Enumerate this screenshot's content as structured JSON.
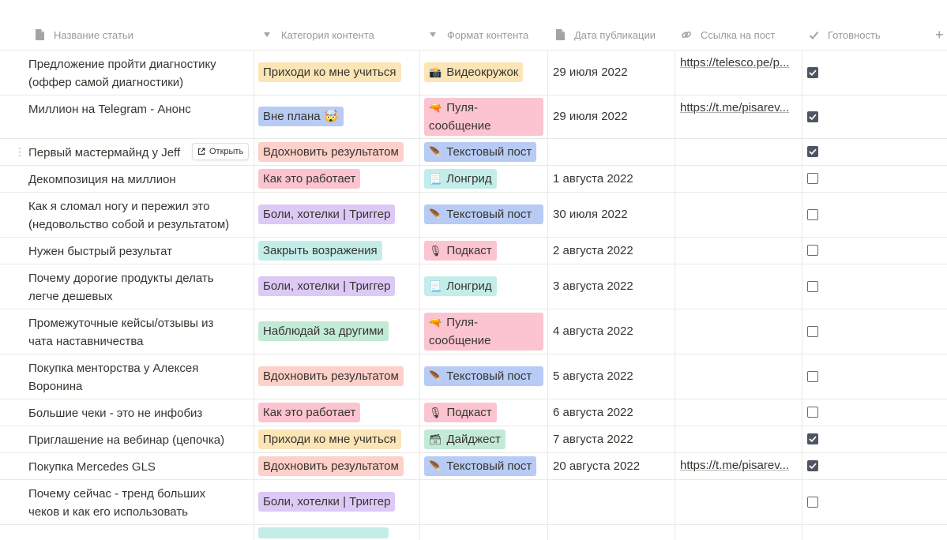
{
  "headers": {
    "title": "Название статьи",
    "category": "Категория контента",
    "format": "Формат контента",
    "date": "Дата публикации",
    "link": "Ссылка на пост",
    "ready": "Готовность",
    "add": "+"
  },
  "open_button": "Открыть",
  "colors": {
    "yellow": "#fbe5b6",
    "purple": "#dcc9f6",
    "red": "#fdd0c9",
    "pink": "#fbc4d0",
    "blue": "#b7cbf4",
    "teal": "#c4ede9",
    "green": "#c3ead7",
    "checkbox": "#4f5563"
  },
  "rows": [
    {
      "title": [
        "Предложение пройти диагностику",
        "(оффер самой диагностики)"
      ],
      "category": "Приходи ко мне учиться",
      "cat_color": "yellow",
      "format_emoji": "📸",
      "format": "Видеокружок",
      "fmt_color": "yellow",
      "date": "29 июля 2022",
      "link": "https://telesco.pe/p...",
      "done": true
    },
    {
      "title": [
        "Миллион на Telegram - Анонс"
      ],
      "category": "Вне плана 🤯",
      "cat_color": "blue",
      "format_emoji": "🔫",
      "format": "Пуля-сообщение",
      "fmt_color": "pink",
      "date": "29 июля 2022",
      "link": "https://t.me/pisarev...",
      "done": true
    },
    {
      "title": [
        "Первый мастермайнд у Jeff"
      ],
      "category": "Вдохновить результатом",
      "cat_color": "red",
      "format_emoji": "🪶",
      "format": "Текстовый пост",
      "fmt_color": "blue",
      "date": "",
      "link": "",
      "done": true
    },
    {
      "title": [
        "Декомпозиция на миллион"
      ],
      "category": "Как это работает",
      "cat_color": "pink",
      "format_emoji": "📃",
      "format": "Лонгрид",
      "fmt_color": "teal",
      "date": "1 августа 2022",
      "link": "",
      "done": false
    },
    {
      "title": [
        "Как я сломал ногу и пережил это",
        "(недовольство собой и результатом)"
      ],
      "category": "Боли, хотелки | Триггер",
      "cat_color": "purple",
      "format_emoji": "🪶",
      "format": "Текстовый пост",
      "fmt_color": "blue",
      "date": "30 июля 2022",
      "link": "",
      "done": false
    },
    {
      "title": [
        "Нужен быстрый результат"
      ],
      "category": "Закрыть возражения",
      "cat_color": "teal",
      "format_emoji": "🎙",
      "format": "Подкаст",
      "fmt_color": "pink",
      "date": "2 августа 2022",
      "link": "",
      "done": false
    },
    {
      "title": [
        "Почему дорогие продукты делать",
        "легче дешевых"
      ],
      "category": "Боли, хотелки | Триггер",
      "cat_color": "purple",
      "format_emoji": "📃",
      "format": "Лонгрид",
      "fmt_color": "teal",
      "date": "3 августа 2022",
      "link": "",
      "done": false
    },
    {
      "title": [
        "Промежуточные кейсы/отзывы из",
        "чата наставничества"
      ],
      "category": "Наблюдай за другими",
      "cat_color": "green",
      "format_emoji": "🔫",
      "format": "Пуля-сообщение",
      "fmt_color": "pink",
      "date": "4 августа 2022",
      "link": "",
      "done": false
    },
    {
      "title": [
        "Покупка менторства у Алексея",
        "Воронина"
      ],
      "category": "Вдохновить результатом",
      "cat_color": "red",
      "format_emoji": "🪶",
      "format": "Текстовый пост",
      "fmt_color": "blue",
      "date": "5 августа 2022",
      "link": "",
      "done": false
    },
    {
      "title": [
        "Большие чеки - это не инфобиз"
      ],
      "category": "Как это работает",
      "cat_color": "pink",
      "format_emoji": "🎙",
      "format": "Подкаст",
      "fmt_color": "pink",
      "date": "6 августа 2022",
      "link": "",
      "done": false
    },
    {
      "title": [
        "Приглашение на вебинар (цепочка)"
      ],
      "category": "Приходи ко мне учиться",
      "cat_color": "yellow",
      "format_emoji": "🗃",
      "format": "Дайджест",
      "fmt_color": "green",
      "date": "7 августа 2022",
      "link": "",
      "done": true
    },
    {
      "title": [
        "Покупка Mercedes GLS"
      ],
      "category": "Вдохновить результатом",
      "cat_color": "red",
      "format_emoji": "🪶",
      "format": "Текстовый пост",
      "fmt_color": "blue",
      "date": "20 августа 2022",
      "link": "https://t.me/pisarev...",
      "done": true
    },
    {
      "title": [
        "Почему сейчас - тренд больших",
        "чеков и как его использовать"
      ],
      "category": "Боли, хотелки | Триггер",
      "cat_color": "purple",
      "format_emoji": "",
      "format": "",
      "fmt_color": "",
      "date": "",
      "link": "",
      "done": false
    }
  ]
}
